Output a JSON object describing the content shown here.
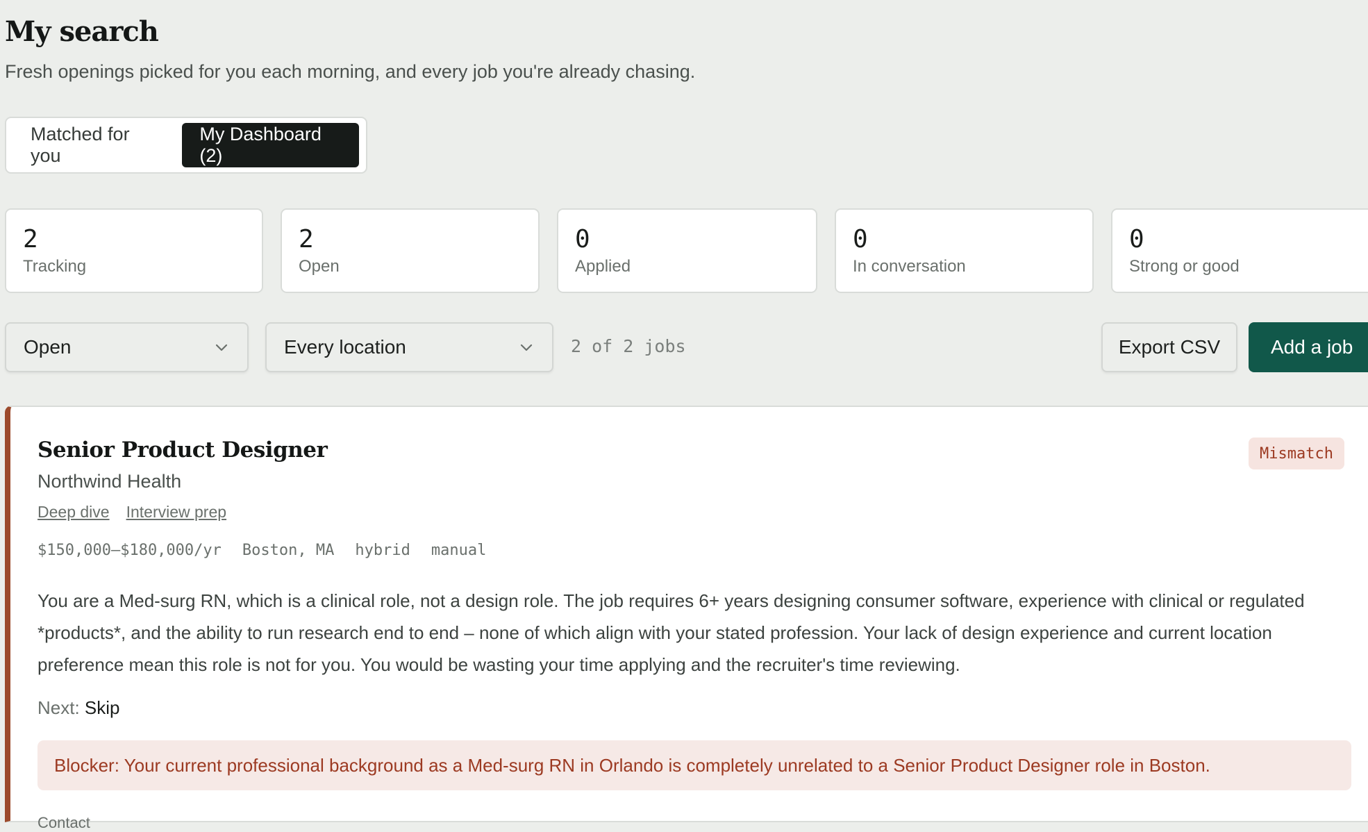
{
  "header": {
    "title": "My search",
    "subtitle": "Fresh openings picked for you each morning, and every job you're already chasing."
  },
  "tabs": [
    {
      "label": "Matched for you",
      "active": false
    },
    {
      "label": "My Dashboard (2)",
      "active": true
    }
  ],
  "stats": [
    {
      "value": "2",
      "label": "Tracking"
    },
    {
      "value": "2",
      "label": "Open"
    },
    {
      "value": "0",
      "label": "Applied"
    },
    {
      "value": "0",
      "label": "In conversation"
    },
    {
      "value": "0",
      "label": "Strong or good"
    }
  ],
  "filters": {
    "status": {
      "selected": "Open",
      "icon": "chevron-down-icon"
    },
    "location": {
      "selected": "Every location",
      "icon": "chevron-down-icon"
    },
    "count_text": "2 of 2 jobs"
  },
  "actions": {
    "export_label": "Export CSV",
    "add_label": "Add a job"
  },
  "job": {
    "title": "Senior Product Designer",
    "company": "Northwind Health",
    "links": [
      "Deep dive",
      "Interview prep"
    ],
    "fit_badge": "Mismatch",
    "salary": "$150,000–$180,000/yr",
    "location": "Boston, MA",
    "work_mode": "hybrid",
    "source": "manual",
    "summary": "You are a Med-surg RN, which is a clinical role, not a design role. The job requires 6+ years designing consumer software, experience with clinical or regulated *products*, and the ability to run research end to end – none of which align with your stated profession. Your lack of design experience and current location preference mean this role is not for you. You would be wasting your time applying and the recruiter's time reviewing.",
    "next_label": "Next:",
    "next_value": "Skip",
    "blocker": "Blocker: Your current professional background as a Med-surg RN in Orlando is completely unrelated to a Senior Product Designer role in Boston.",
    "cutoff_text": "Contact"
  },
  "colors": {
    "background": "#eceeeb",
    "accent": "#11584a",
    "active_tab": "#171b19",
    "mismatch": "#9c3a22",
    "card_border_left": "#9c4a2c"
  }
}
